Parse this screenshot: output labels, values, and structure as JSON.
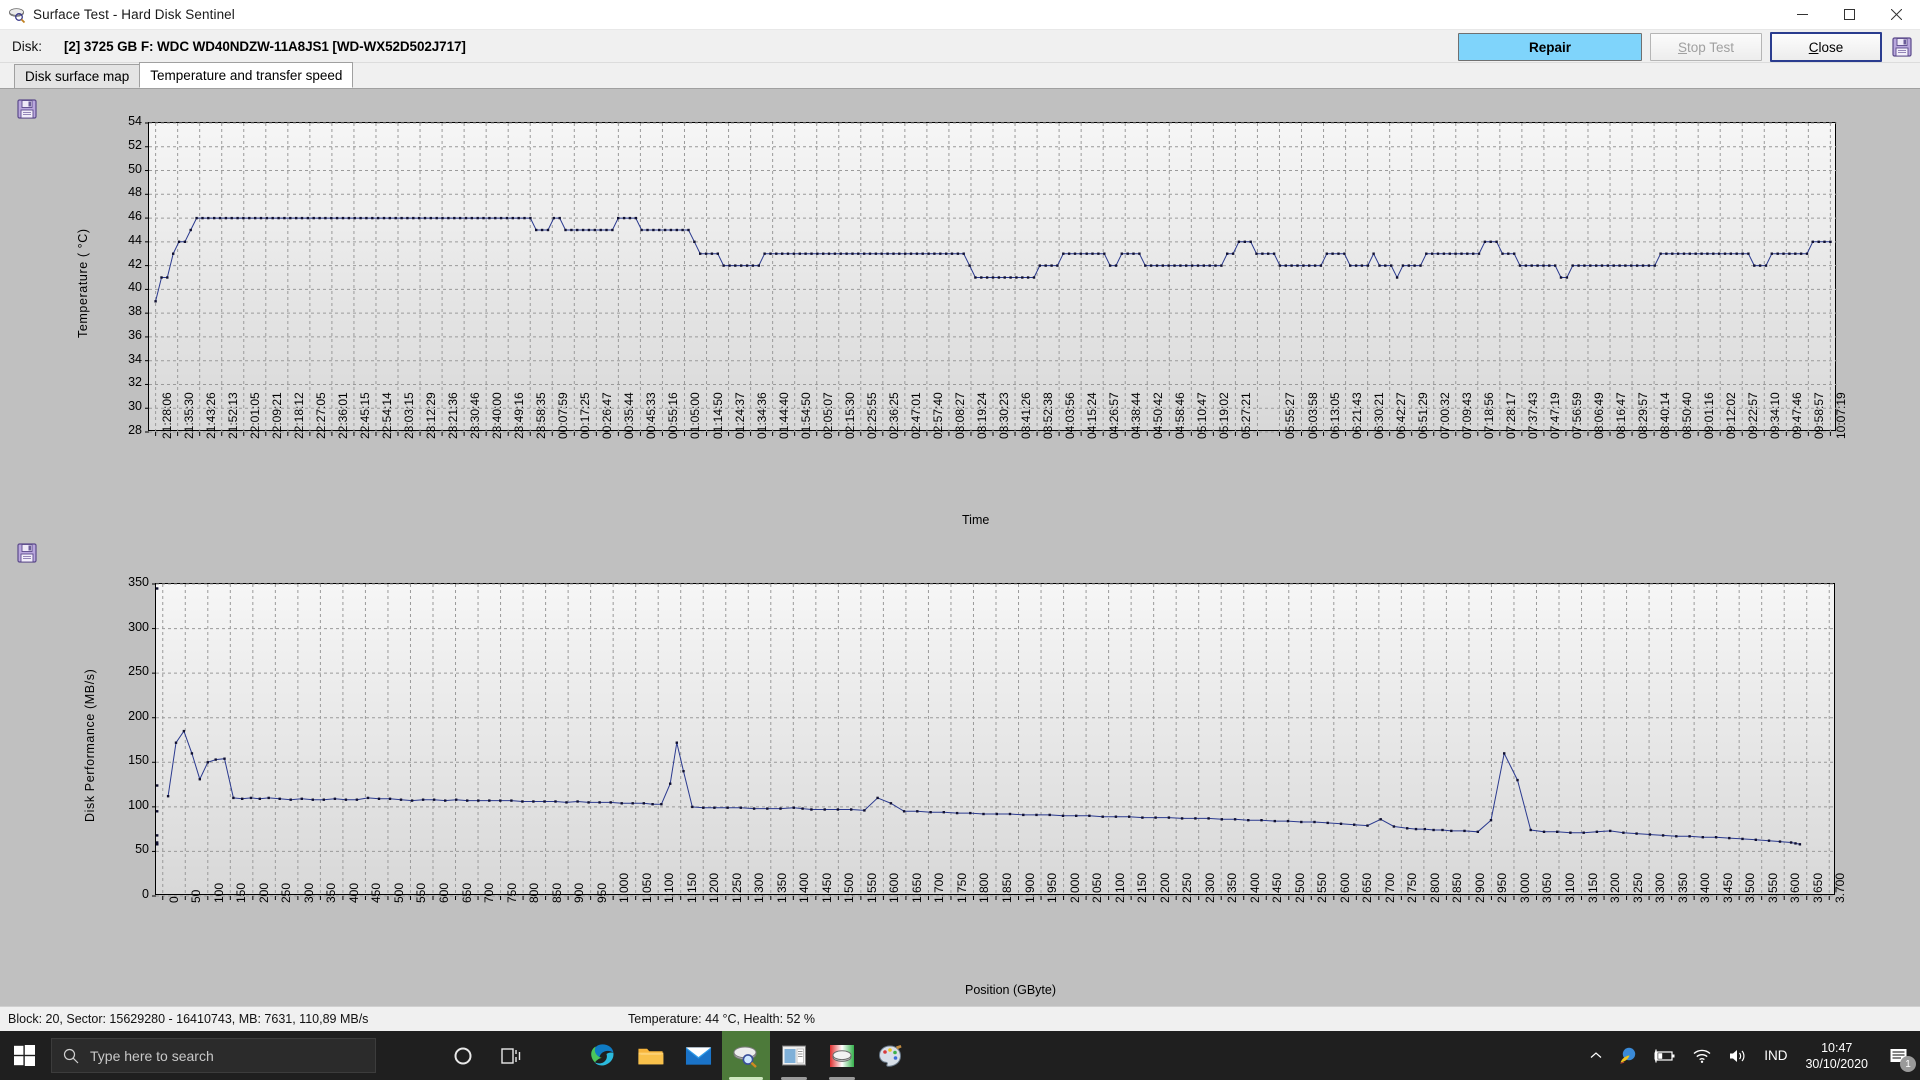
{
  "window": {
    "title": "Surface Test - Hard Disk Sentinel",
    "icon": "disk-magnifier-icon",
    "minimize": "minimize-icon",
    "maximize": "maximize-icon",
    "close": "close-icon"
  },
  "diskbar": {
    "label": "Disk:",
    "value": "[2] 3725 GB F: WDC WD40NDZW-11A8JS1 [WD-WX52D502J717]",
    "repair_label": "Repair",
    "stop_label": "Stop Test",
    "stop_accel": "S",
    "close_label": "Close",
    "close_accel": "C",
    "save_icon": "save-floppy-icon",
    "repair_color": "#7fd4fb"
  },
  "tabs": [
    {
      "label": "Disk surface map",
      "active": false
    },
    {
      "label": "Temperature and transfer speed",
      "active": true
    }
  ],
  "status": {
    "left": "Block: 20, Sector: 15629280 - 16410743, MB: 7631, 110,89 MB/s",
    "right": "Temperature: 44  °C,  Health: 52 %"
  },
  "taskbar": {
    "start_icon": "windows-start-icon",
    "search_placeholder": "Type here to search",
    "search_icon": "search-icon",
    "cortana_icon": "cortana-circle-icon",
    "taskview_icon": "task-view-icon",
    "apps": [
      {
        "name": "edge-icon",
        "active": false,
        "running": true
      },
      {
        "name": "file-explorer-icon",
        "active": false,
        "running": true
      },
      {
        "name": "mail-icon",
        "active": false,
        "running": false
      },
      {
        "name": "hard-disk-sentinel-icon",
        "active": true,
        "running": true
      },
      {
        "name": "app-window-icon",
        "active": false,
        "running": true
      },
      {
        "name": "disk-tool-icon",
        "active": false,
        "running": true
      },
      {
        "name": "paint-icon",
        "active": false,
        "running": false
      }
    ],
    "tray": {
      "chevron": "show-hidden-icons-icon",
      "idm": "internet-download-manager-icon",
      "battery": "battery-charging-icon",
      "wifi": "wifi-icon",
      "volume": "volume-icon",
      "language": "IND",
      "time": "10:47",
      "date": "30/10/2020",
      "notification_icon": "action-center-icon",
      "notification_count": "1"
    }
  },
  "chart_data": [
    {
      "id": "temperature-chart",
      "type": "line",
      "title": "",
      "xlabel": "Time",
      "ylabel": "Temperature ( °C)",
      "ylim": [
        28,
        54
      ],
      "yticks": [
        28,
        30,
        32,
        34,
        36,
        38,
        40,
        42,
        44,
        46,
        48,
        50,
        52,
        54
      ],
      "grid": true,
      "line_color": "#2b3a8f",
      "marker": "square",
      "xtick_labels": [
        "21:28:06",
        "21:35:30",
        "21:43:26",
        "21:52:13",
        "22:01:05",
        "22:09:21",
        "22:18:12",
        "22:27:05",
        "22:36:01",
        "22:45:15",
        "22:54:14",
        "23:03:15",
        "23:12:29",
        "23:21:36",
        "23:30:46",
        "23:40:00",
        "23:49:16",
        "23:58:35",
        "00:07:59",
        "00:17:25",
        "00:26:47",
        "00:35:44",
        "00:45:33",
        "00:55:16",
        "01:05:00",
        "01:14:50",
        "01:24:37",
        "01:34:36",
        "01:44:40",
        "01:54:50",
        "02:05:07",
        "02:15:30",
        "02:25:55",
        "02:36:25",
        "02:47:01",
        "02:57:40",
        "03:08:27",
        "03:19:24",
        "03:30:23",
        "03:41:26",
        "03:52:38",
        "04:03:56",
        "04:15:24",
        "04:26:57",
        "04:38:44",
        "04:50:42",
        "04:58:46",
        "05:10:47",
        "05:19:02",
        "05:27:21",
        "",
        "05:55:27",
        "06:03:58",
        "06:13:05",
        "06:21:43",
        "06:30:21",
        "06:42:27",
        "06:51:29",
        "07:00:32",
        "07:09:43",
        "07:18:56",
        "07:28:17",
        "07:37:43",
        "07:47:19",
        "07:56:59",
        "08:06:49",
        "08:16:47",
        "08:29:57",
        "08:40:14",
        "08:50:40",
        "09:01:16",
        "09:12:02",
        "09:22:57",
        "09:34:10",
        "09:47:46",
        "09:58:57",
        "10:07:19"
      ],
      "values": [
        39,
        41,
        41,
        43,
        44,
        44,
        45,
        46,
        46,
        46,
        46,
        46,
        46,
        46,
        46,
        46,
        46,
        46,
        46,
        46,
        46,
        46,
        46,
        46,
        46,
        46,
        46,
        46,
        46,
        46,
        46,
        46,
        46,
        46,
        46,
        46,
        46,
        46,
        46,
        46,
        46,
        46,
        46,
        46,
        46,
        46,
        46,
        46,
        46,
        46,
        46,
        46,
        46,
        46,
        46,
        46,
        46,
        46,
        46,
        46,
        46,
        46,
        46,
        46,
        46,
        45,
        45,
        45,
        46,
        46,
        45,
        45,
        45,
        45,
        45,
        45,
        45,
        45,
        45,
        46,
        46,
        46,
        46,
        45,
        45,
        45,
        45,
        45,
        45,
        45,
        45,
        45,
        44,
        43,
        43,
        43,
        43,
        42,
        42,
        42,
        42,
        42,
        42,
        42,
        43,
        43,
        43,
        43,
        43,
        43,
        43,
        43,
        43,
        43,
        43,
        43,
        43,
        43,
        43,
        43,
        43,
        43,
        43,
        43,
        43,
        43,
        43,
        43,
        43,
        43,
        43,
        43,
        43,
        43,
        43,
        43,
        43,
        43,
        43,
        42,
        41,
        41,
        41,
        41,
        41,
        41,
        41,
        41,
        41,
        41,
        41,
        42,
        42,
        42,
        42,
        43,
        43,
        43,
        43,
        43,
        43,
        43,
        43,
        42,
        42,
        43,
        43,
        43,
        43,
        42,
        42,
        42,
        42,
        42,
        42,
        42,
        42,
        42,
        42,
        42,
        42,
        42,
        42,
        43,
        43,
        44,
        44,
        44,
        43,
        43,
        43,
        43,
        42,
        42,
        42,
        42,
        42,
        42,
        42,
        42,
        43,
        43,
        43,
        43,
        42,
        42,
        42,
        42,
        43,
        42,
        42,
        42,
        41,
        42,
        42,
        42,
        42,
        43,
        43,
        43,
        43,
        43,
        43,
        43,
        43,
        43,
        43,
        44,
        44,
        44,
        43,
        43,
        43,
        42,
        42,
        42,
        42,
        42,
        42,
        42,
        41,
        41,
        42,
        42,
        42,
        42,
        42,
        42,
        42,
        42,
        42,
        42,
        42,
        42,
        42,
        42,
        42,
        43,
        43,
        43,
        43,
        43,
        43,
        43,
        43,
        43,
        43,
        43,
        43,
        43,
        43,
        43,
        43,
        42,
        42,
        42,
        43,
        43,
        43,
        43,
        43,
        43,
        43,
        44,
        44,
        44,
        44
      ]
    },
    {
      "id": "disk-performance-chart",
      "type": "line",
      "title": "",
      "xlabel": "Position (GByte)",
      "ylabel": "Disk Performance (MB/s)",
      "ylim": [
        0,
        350
      ],
      "yticks": [
        0,
        50,
        100,
        150,
        200,
        250,
        300,
        350
      ],
      "grid": true,
      "line_color": "#2b3a8f",
      "marker": "square",
      "xtick_labels": [
        "0",
        "50",
        "100",
        "150",
        "200",
        "250",
        "300",
        "350",
        "400",
        "450",
        "500",
        "550",
        "600",
        "650",
        "700",
        "750",
        "800",
        "850",
        "900",
        "950",
        "1.000",
        "1.050",
        "1.100",
        "1.150",
        "1.200",
        "1.250",
        "1.300",
        "1.350",
        "1.400",
        "1.450",
        "1.500",
        "1.550",
        "1.600",
        "1.650",
        "1.700",
        "1.750",
        "1.800",
        "1.850",
        "1.900",
        "1.950",
        "2.000",
        "2.050",
        "2.100",
        "2.150",
        "2.200",
        "2.250",
        "2.300",
        "2.350",
        "2.400",
        "2.450",
        "2.500",
        "2.550",
        "2.600",
        "2.650",
        "2.700",
        "2.750",
        "2.800",
        "2.850",
        "2.900",
        "2.950",
        "3.000",
        "3.050",
        "3.100",
        "3.150",
        "3.200",
        "3.250",
        "3.300",
        "3.350",
        "3.400",
        "3.450",
        "3.500",
        "3.550",
        "3.600",
        "3.650",
        "3.700"
      ],
      "x": [
        12,
        30,
        48,
        66,
        84,
        102,
        120,
        140,
        160,
        180,
        200,
        220,
        240,
        265,
        290,
        315,
        340,
        365,
        390,
        415,
        440,
        465,
        490,
        515,
        540,
        565,
        590,
        615,
        640,
        665,
        690,
        715,
        740,
        765,
        790,
        815,
        840,
        865,
        890,
        915,
        940,
        965,
        990,
        1015,
        1040,
        1065,
        1090,
        1110,
        1130,
        1150,
        1165,
        1180,
        1200,
        1225,
        1250,
        1280,
        1310,
        1340,
        1370,
        1400,
        1430,
        1450,
        1470,
        1500,
        1530,
        1560,
        1590,
        1620,
        1650,
        1680,
        1710,
        1740,
        1770,
        1800,
        1830,
        1860,
        1890,
        1920,
        1950,
        1980,
        2010,
        2040,
        2070,
        2100,
        2130,
        2160,
        2190,
        2220,
        2250,
        2280,
        2310,
        2340,
        2370,
        2400,
        2430,
        2460,
        2490,
        2520,
        2550,
        2580,
        2610,
        2640,
        2670,
        2700,
        2730,
        2760,
        2790,
        2820,
        2840,
        2860,
        2880,
        2900,
        2920,
        2950,
        2980,
        3010,
        3040,
        3070,
        3100,
        3130,
        3160,
        3190,
        3220,
        3250,
        3280,
        3310,
        3340,
        3370,
        3400,
        3430,
        3460,
        3490,
        3520,
        3550,
        3580,
        3610,
        3640,
        3665,
        3690,
        3700,
        3710
      ],
      "values": [
        112,
        172,
        185,
        160,
        131,
        150,
        153,
        154,
        110,
        109,
        110,
        109,
        110,
        109,
        108,
        109,
        108,
        108,
        109,
        108,
        108,
        110,
        109,
        109,
        108,
        107,
        108,
        108,
        107,
        108,
        107,
        107,
        107,
        107,
        107,
        106,
        106,
        106,
        106,
        105,
        106,
        105,
        105,
        105,
        104,
        104,
        104,
        103,
        103,
        126,
        172,
        140,
        100,
        99,
        99,
        99,
        99,
        98,
        98,
        98,
        99,
        98,
        97,
        97,
        97,
        97,
        96,
        110,
        104,
        95,
        95,
        94,
        94,
        93,
        93,
        92,
        92,
        92,
        91,
        91,
        91,
        90,
        90,
        90,
        89,
        89,
        89,
        88,
        88,
        88,
        87,
        87,
        87,
        86,
        86,
        85,
        85,
        84,
        84,
        83,
        83,
        82,
        81,
        80,
        79,
        86,
        78,
        76,
        75,
        75,
        74,
        74,
        73,
        73,
        72,
        85,
        160,
        130,
        74,
        72,
        72,
        71,
        71,
        72,
        73,
        71,
        70,
        69,
        68,
        67,
        67,
        66,
        66,
        65,
        64,
        63,
        62,
        61,
        60,
        59,
        58,
        58,
        58,
        60,
        68,
        95,
        124,
        345
      ]
    }
  ]
}
